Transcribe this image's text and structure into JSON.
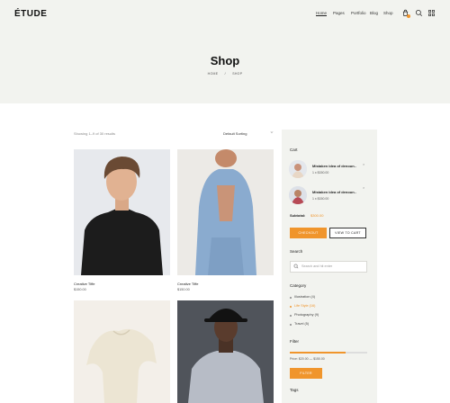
{
  "header": {
    "logo": "ÉTUDE",
    "nav": [
      "Home",
      "Pages",
      "Portfolio",
      "Blog",
      "Shop"
    ],
    "active_nav": "Home",
    "accent_color": "#f0952c"
  },
  "hero": {
    "title": "Shop",
    "breadcrumb": [
      "HOME",
      "SHOP"
    ],
    "background": "#f2f3ef"
  },
  "toolbar": {
    "results_text": "Showing 1–9 of 30 results",
    "sort_value": "Default Sorting"
  },
  "products": [
    {
      "name": "Creative Tiffe",
      "price": "$150.00"
    },
    {
      "name": "Creative Tiffe",
      "price": "$150.00"
    },
    {
      "name": "",
      "price": ""
    },
    {
      "name": "",
      "price": ""
    }
  ],
  "sidebar": {
    "cart": {
      "heading": "Cart",
      "items": [
        {
          "name": "Mistaken idea of denoun..",
          "qty": "1 x $150.00"
        },
        {
          "name": "Mistaken idea of denoun..",
          "qty": "1 x $150.00"
        }
      ],
      "subtotal_label": "Subtotal:",
      "subtotal_value": "$300.00",
      "checkout_label": "CHECKOUT",
      "view_cart_label": "VIEW TO CART"
    },
    "search": {
      "heading": "Search",
      "placeholder": "Search and hit enter"
    },
    "category": {
      "heading": "Category",
      "items": [
        "Illustration (4)",
        "Life Style (16)",
        "Photography (9)",
        "Travel (5)"
      ],
      "active_index": 1
    },
    "filter": {
      "heading": "Filter",
      "range_fraction": 0.72,
      "price_text": "Price: $20.00 — $150.00",
      "button_label": "FILTER"
    },
    "tags": {
      "heading": "Tags"
    }
  }
}
